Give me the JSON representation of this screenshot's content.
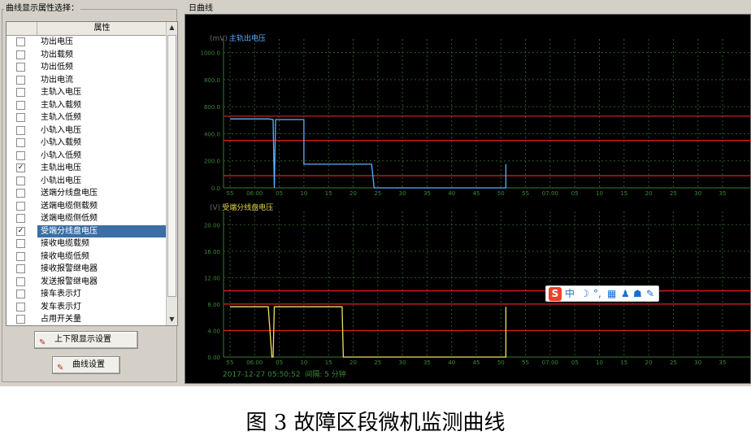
{
  "left_panel": {
    "title": "曲线显示属性选择：",
    "column_header": "属性",
    "items": [
      {
        "label": "功出电压",
        "checked": false,
        "selected": false
      },
      {
        "label": "功出载频",
        "checked": false,
        "selected": false
      },
      {
        "label": "功出低频",
        "checked": false,
        "selected": false
      },
      {
        "label": "功出电流",
        "checked": false,
        "selected": false
      },
      {
        "label": "主轨入电压",
        "checked": false,
        "selected": false
      },
      {
        "label": "主轨入载频",
        "checked": false,
        "selected": false
      },
      {
        "label": "主轨入低频",
        "checked": false,
        "selected": false
      },
      {
        "label": "小轨入电压",
        "checked": false,
        "selected": false
      },
      {
        "label": "小轨入载频",
        "checked": false,
        "selected": false
      },
      {
        "label": "小轨入低频",
        "checked": false,
        "selected": false
      },
      {
        "label": "主轨出电压",
        "checked": true,
        "selected": false
      },
      {
        "label": "小轨出电压",
        "checked": false,
        "selected": false
      },
      {
        "label": "送端分线盘电压",
        "checked": false,
        "selected": false
      },
      {
        "label": "送端电缆侧载频",
        "checked": false,
        "selected": false
      },
      {
        "label": "送端电缆侧低频",
        "checked": false,
        "selected": false
      },
      {
        "label": "受端分线盘电压",
        "checked": true,
        "selected": true
      },
      {
        "label": "接收电缆载频",
        "checked": false,
        "selected": false
      },
      {
        "label": "接收电缆低频",
        "checked": false,
        "selected": false
      },
      {
        "label": "接收报警继电器",
        "checked": false,
        "selected": false
      },
      {
        "label": "发送报警继电器",
        "checked": false,
        "selected": false
      },
      {
        "label": "接车表示灯",
        "checked": false,
        "selected": false
      },
      {
        "label": "发车表示灯",
        "checked": false,
        "selected": false
      },
      {
        "label": "占用开关量",
        "checked": false,
        "selected": false
      }
    ],
    "buttons": {
      "limits": "上下限显示设置",
      "curve": "曲线设置"
    }
  },
  "right_panel": {
    "title": "日曲线",
    "footer_timestamp": "2017-12-27 05:50:52",
    "footer_interval": "间隔: 5 分钟"
  },
  "ime_bar": {
    "logo": "S",
    "mode": "中",
    "icons": [
      "moon-icon",
      "punctuation-icon",
      "keyboard-icon",
      "user-icon",
      "shirt-icon",
      "wrench-icon"
    ]
  },
  "caption": "图 3 故障区段微机监测曲线",
  "colors": {
    "blue_series": "#5ab0ff",
    "yellow_series": "#f0e060",
    "limit_lines": "#e02020",
    "grid": "#2a6a2a",
    "selection": "#3a6ea5"
  },
  "chart_data": [
    {
      "type": "line",
      "title": "主轨出电压",
      "unit": "(mV)",
      "x_ticks": [
        "55",
        "06:00",
        "05",
        "10",
        "15",
        "20",
        "25",
        "30",
        "35",
        "40",
        "45",
        "50",
        "55",
        "07:00",
        "05",
        "10",
        "15",
        "20",
        "25",
        "30",
        "35"
      ],
      "y_ticks": [
        "0.0",
        "200.0",
        "400.0",
        "600.0",
        "800.0",
        "1000.0"
      ],
      "ylim": [
        0,
        1100
      ],
      "limit_lines": [
        90,
        350,
        530
      ],
      "series": [
        {
          "color": "#5ab0ff",
          "x": [
            0.0,
            1.55,
            1.75,
            1.8,
            1.85,
            3.0,
            3.0,
            4.55,
            4.55,
            5.0,
            5.75,
            5.85,
            11.2,
            11.2
          ],
          "y": [
            510,
            510,
            505,
            0,
            505,
            505,
            175,
            175,
            175,
            175,
            175,
            0,
            0,
            175
          ]
        }
      ]
    },
    {
      "type": "line",
      "title": "受端分线盘电压",
      "unit": "(V)",
      "x_ticks": [
        "55",
        "06:00",
        "05",
        "10",
        "15",
        "20",
        "25",
        "30",
        "35",
        "40",
        "45",
        "50",
        "55",
        "07:00",
        "05",
        "10",
        "15",
        "20",
        "25",
        "30",
        "35"
      ],
      "y_ticks": [
        "0.00",
        "4.00",
        "8.00",
        "12.00",
        "16.00",
        "20.00"
      ],
      "ylim": [
        0,
        22
      ],
      "limit_lines": [
        4.0,
        8.0,
        10.0
      ],
      "series": [
        {
          "color": "#f0e060",
          "x": [
            0.0,
            1.55,
            1.7,
            1.75,
            1.8,
            4.55,
            4.6,
            11.2,
            11.2
          ],
          "y": [
            7.6,
            7.6,
            0,
            0,
            7.6,
            7.6,
            0,
            0,
            7.6
          ]
        }
      ]
    }
  ]
}
